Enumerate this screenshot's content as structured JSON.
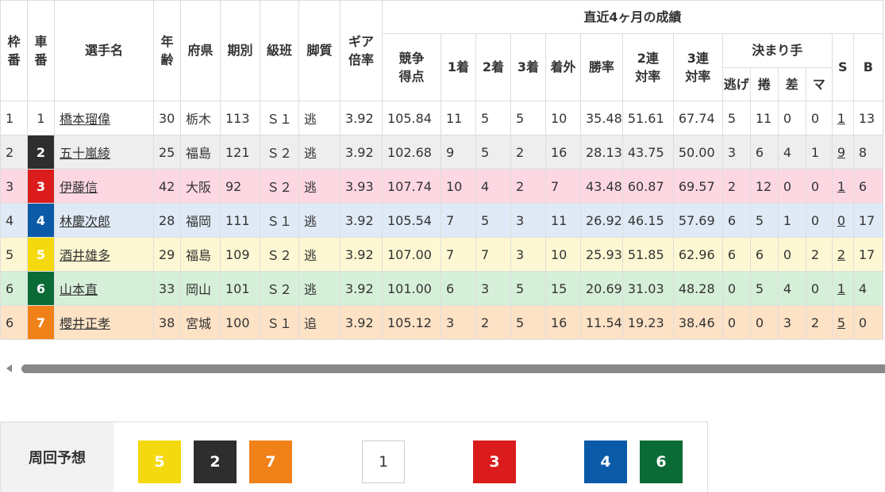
{
  "table": {
    "headers": {
      "waku": "枠\n番",
      "sha": "車\n番",
      "name": "選手名",
      "age": "年\n齢",
      "pref": "府県",
      "term": "期別",
      "class": "級班",
      "leg": "脚質",
      "gear": "ギア\n倍率",
      "recent_group": "直近4ヶ月の成績",
      "score": "競争\n得点",
      "first": "1着",
      "second": "2着",
      "third": "3着",
      "out": "着外",
      "win_rate": "勝率",
      "rate2": "2連\n対率",
      "rate3": "3連\n対率",
      "kimarite_group": "決まり手",
      "nige": "逃げ",
      "makuri": "捲",
      "sashi": "差",
      "mark": "マ",
      "s": "S",
      "b": "B"
    },
    "rows": [
      {
        "waku": "1",
        "sha": "1",
        "name": "橋本瑠偉",
        "age": "30",
        "pref": "栃木",
        "term": "113",
        "class": "Ｓ１",
        "leg": "逃",
        "gear": "3.92",
        "score": "105.84",
        "first": "11",
        "second": "5",
        "third": "5",
        "out": "10",
        "win": "35.48",
        "r2": "51.61",
        "r3": "67.74",
        "nige": "5",
        "makuri": "11",
        "sashi": "0",
        "mark": "0",
        "s": "1",
        "b": "13"
      },
      {
        "waku": "2",
        "sha": "2",
        "name": "五十嵐綾",
        "age": "25",
        "pref": "福島",
        "term": "121",
        "class": "Ｓ２",
        "leg": "逃",
        "gear": "3.92",
        "score": "102.68",
        "first": "9",
        "second": "5",
        "third": "2",
        "out": "16",
        "win": "28.13",
        "r2": "43.75",
        "r3": "50.00",
        "nige": "3",
        "makuri": "6",
        "sashi": "4",
        "mark": "1",
        "s": "9",
        "b": "8"
      },
      {
        "waku": "3",
        "sha": "3",
        "name": "伊藤信",
        "age": "42",
        "pref": "大阪",
        "term": "92",
        "class": "Ｓ２",
        "leg": "逃",
        "gear": "3.93",
        "score": "107.74",
        "first": "10",
        "second": "4",
        "third": "2",
        "out": "7",
        "win": "43.48",
        "r2": "60.87",
        "r3": "69.57",
        "nige": "2",
        "makuri": "12",
        "sashi": "0",
        "mark": "0",
        "s": "1",
        "b": "6"
      },
      {
        "waku": "4",
        "sha": "4",
        "name": "林慶次郎",
        "age": "28",
        "pref": "福岡",
        "term": "111",
        "class": "Ｓ１",
        "leg": "逃",
        "gear": "3.92",
        "score": "105.54",
        "first": "7",
        "second": "5",
        "third": "3",
        "out": "11",
        "win": "26.92",
        "r2": "46.15",
        "r3": "57.69",
        "nige": "6",
        "makuri": "5",
        "sashi": "1",
        "mark": "0",
        "s": "0",
        "b": "17"
      },
      {
        "waku": "5",
        "sha": "5",
        "name": "酒井雄多",
        "age": "29",
        "pref": "福島",
        "term": "109",
        "class": "Ｓ２",
        "leg": "逃",
        "gear": "3.92",
        "score": "107.00",
        "first": "7",
        "second": "7",
        "third": "3",
        "out": "10",
        "win": "25.93",
        "r2": "51.85",
        "r3": "62.96",
        "nige": "6",
        "makuri": "6",
        "sashi": "0",
        "mark": "2",
        "s": "2",
        "b": "17"
      },
      {
        "waku": "6",
        "sha": "6",
        "name": "山本直",
        "age": "33",
        "pref": "岡山",
        "term": "101",
        "class": "Ｓ２",
        "leg": "逃",
        "gear": "3.92",
        "score": "101.00",
        "first": "6",
        "second": "3",
        "third": "5",
        "out": "15",
        "win": "20.69",
        "r2": "31.03",
        "r3": "48.28",
        "nige": "0",
        "makuri": "5",
        "sashi": "4",
        "mark": "0",
        "s": "1",
        "b": "4"
      },
      {
        "waku": "6",
        "sha": "7",
        "name": "櫻井正孝",
        "age": "38",
        "pref": "宮城",
        "term": "100",
        "class": "Ｓ１",
        "leg": "追",
        "gear": "3.92",
        "score": "105.12",
        "first": "3",
        "second": "2",
        "third": "5",
        "out": "16",
        "win": "11.54",
        "r2": "19.23",
        "r3": "38.46",
        "nige": "0",
        "makuri": "0",
        "sashi": "3",
        "mark": "2",
        "s": "5",
        "b": "0"
      }
    ]
  },
  "prediction": {
    "label": "周回予想",
    "boxes": [
      {
        "num": "5",
        "bg": "#f5d90f",
        "fg": "#ffffff"
      },
      {
        "num": "2",
        "bg": "#2e2e2e",
        "fg": "#ffffff"
      },
      {
        "num": "7",
        "bg": "#f08018",
        "fg": "#ffffff"
      },
      {
        "num": "1",
        "bg": "#ffffff",
        "fg": "#333333"
      },
      {
        "num": "3",
        "bg": "#db1c1c",
        "fg": "#ffffff"
      },
      {
        "num": "4",
        "bg": "#0a5aa8",
        "fg": "#ffffff"
      },
      {
        "num": "6",
        "bg": "#0b6b36",
        "fg": "#ffffff"
      }
    ]
  }
}
